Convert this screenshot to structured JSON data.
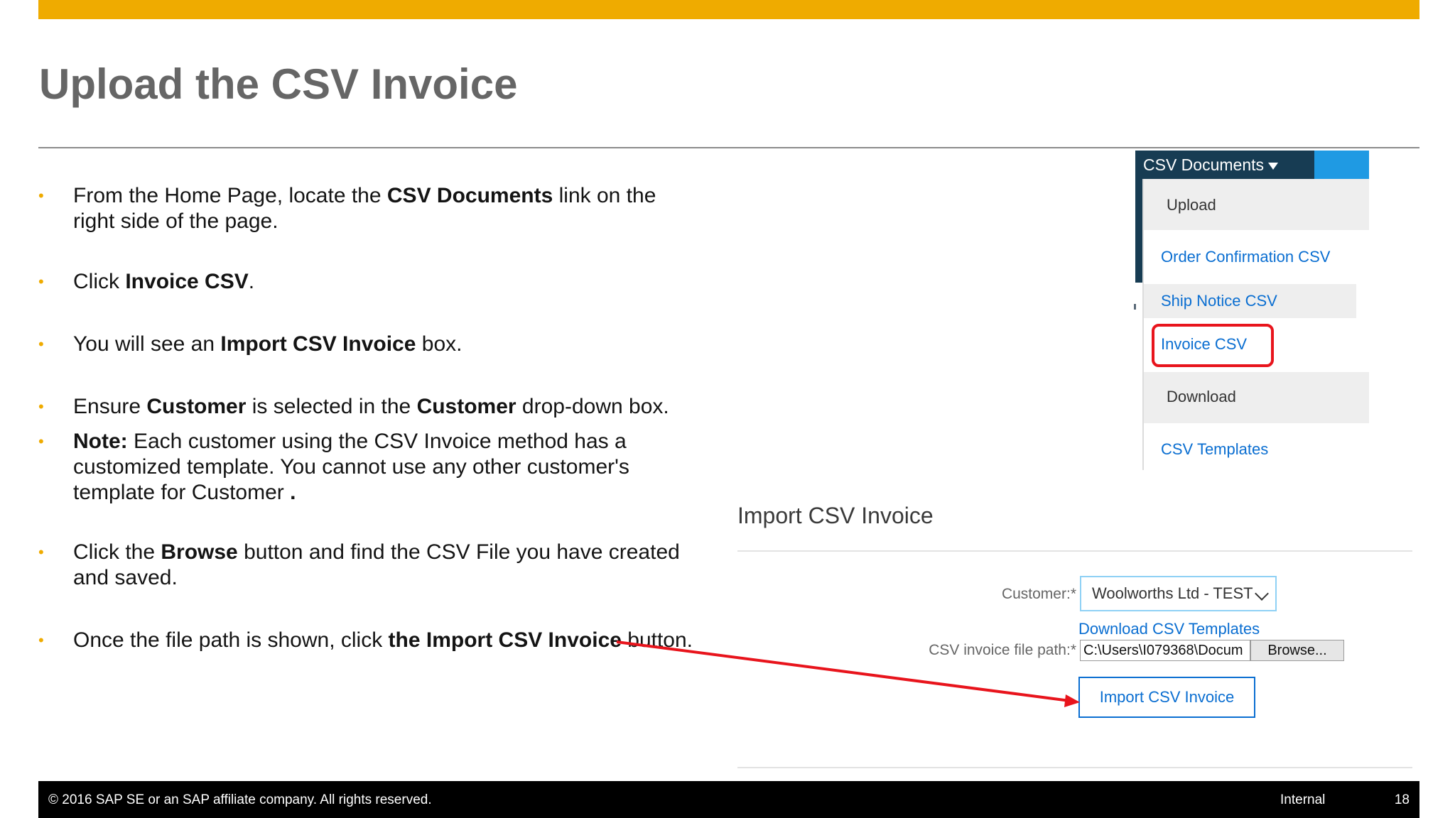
{
  "slide": {
    "title": "Upload the CSV Invoice"
  },
  "bullets": [
    {
      "segments": [
        "From the Home Page, locate the ",
        "CSV Documents",
        " link on the right side of the page."
      ]
    },
    {
      "segments": [
        "Click ",
        "Invoice CSV",
        "."
      ]
    },
    {
      "segments": [
        "You will see an ",
        "Import CSV Invoice",
        " box."
      ]
    },
    {
      "segments": [
        "Ensure ",
        "Customer",
        "  is selected in the ",
        "Customer",
        " drop-down box."
      ]
    },
    {
      "segments": [
        "Note:",
        " Each customer using the CSV Invoice method has a customized template.  You cannot use any other customer's template for Customer",
        " ."
      ]
    },
    {
      "segments": [
        "Click the ",
        "Browse",
        " button and find the CSV File you have created and saved."
      ]
    },
    {
      "segments": [
        "Once the file path is shown, click ",
        "the Import CSV Invoice",
        " button."
      ]
    }
  ],
  "menu": {
    "header": "CSV Documents",
    "items": [
      "Upload",
      "Order Confirmation CSV",
      "Ship Notice CSV",
      "Invoice CSV",
      "Download",
      "CSV Templates"
    ]
  },
  "import_form": {
    "title": "Import CSV Invoice",
    "customer_label": "Customer:",
    "required_mark": "*",
    "customer_value": "Woolworths Ltd - TEST",
    "download_link": "Download CSV Templates",
    "path_label": "CSV invoice file path:",
    "path_value": "C:\\Users\\I079368\\Docum",
    "browse_label": "Browse...",
    "import_button": "Import CSV Invoice"
  },
  "footer": {
    "copyright": "© 2016 SAP SE or an SAP affiliate company. All rights reserved.",
    "classification": "Internal",
    "page_number": "18"
  },
  "colors": {
    "accent_bar": "#efab00",
    "menu_header": "#173c53",
    "link_blue": "#0a6ed1",
    "highlight_red": "#e8141c",
    "arrow_red": "#e8141c"
  }
}
